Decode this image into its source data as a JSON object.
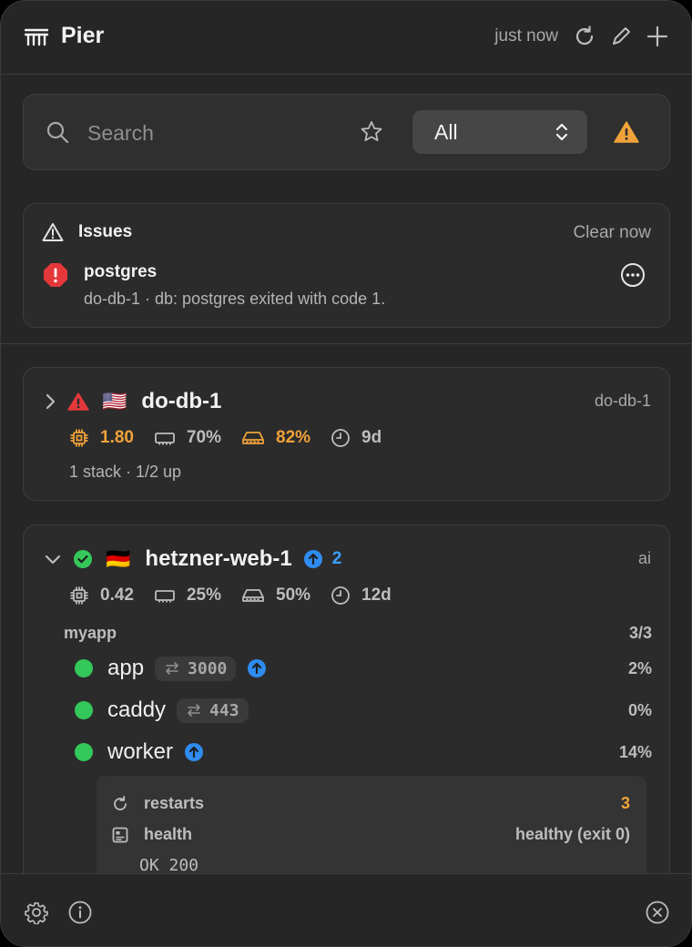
{
  "header": {
    "title": "Pier",
    "updated": "just now"
  },
  "search": {
    "placeholder": "Search",
    "filter_value": "All"
  },
  "issues": {
    "title": "Issues",
    "clear_label": "Clear now",
    "items": [
      {
        "name": "postgres",
        "message": "do-db-1 · db: postgres exited with code 1."
      }
    ]
  },
  "servers": [
    {
      "name": "do-db-1",
      "flag": "🇺🇸",
      "tag": "do-db-1",
      "metrics": {
        "cpu": "1.80",
        "mem": "70%",
        "disk": "82%",
        "uptime": "9d"
      },
      "summary": "1 stack · 1/2 up"
    },
    {
      "name": "hetzner-web-1",
      "flag": "🇩🇪",
      "tag": "ai",
      "updates": "2",
      "metrics": {
        "cpu": "0.42",
        "mem": "25%",
        "disk": "50%",
        "uptime": "12d"
      },
      "stack": {
        "name": "myapp",
        "count": "3/3"
      },
      "services": [
        {
          "name": "app",
          "port": "3000",
          "cpu": "2%"
        },
        {
          "name": "caddy",
          "port": "443",
          "cpu": "0%"
        },
        {
          "name": "worker",
          "cpu": "14%"
        }
      ],
      "detail": {
        "restarts_label": "restarts",
        "restarts": "3",
        "health_label": "health",
        "health": "healthy (exit 0)",
        "output": "OK 200"
      }
    }
  ],
  "colors": {
    "accent_blue": "#2f8cf0",
    "warning": "#f0a23a",
    "error": "#e5383b",
    "ok": "#34c85a"
  }
}
